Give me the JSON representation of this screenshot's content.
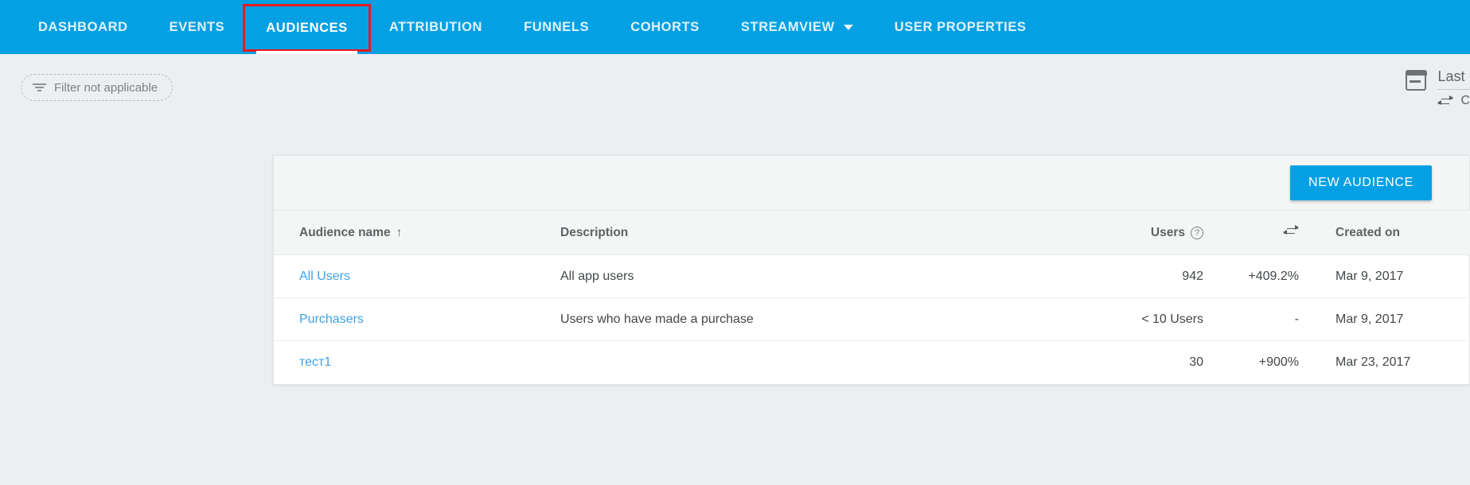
{
  "nav": {
    "items": [
      {
        "label": "DASHBOARD",
        "active": false,
        "has_caret": false
      },
      {
        "label": "EVENTS",
        "active": false,
        "has_caret": false
      },
      {
        "label": "AUDIENCES",
        "active": true,
        "has_caret": false
      },
      {
        "label": "ATTRIBUTION",
        "active": false,
        "has_caret": false
      },
      {
        "label": "FUNNELS",
        "active": false,
        "has_caret": false
      },
      {
        "label": "COHORTS",
        "active": false,
        "has_caret": false
      },
      {
        "label": "STREAMVIEW",
        "active": false,
        "has_caret": true
      },
      {
        "label": "USER PROPERTIES",
        "active": false,
        "has_caret": false
      }
    ],
    "accent_color": "#03a0e4",
    "highlight_box_color": "#e8191d"
  },
  "filter_bar": {
    "chip_label": "Filter not applicable",
    "date_range_line1": "Last",
    "date_range_line2": "C"
  },
  "card": {
    "new_audience_button": "NEW AUDIENCE",
    "columns": {
      "name": "Audience name",
      "name_sort_arrow": "↑",
      "description": "Description",
      "users": "Users",
      "users_help": "?",
      "compare": "",
      "created_on": "Created on"
    },
    "rows": [
      {
        "name": "All Users",
        "description": "All app users",
        "users": "942",
        "delta": "+409.2%",
        "delta_sign": "positive",
        "created_on": "Mar 9, 2017"
      },
      {
        "name": "Purchasers",
        "description": "Users who have made a purchase",
        "users": "< 10 Users",
        "delta": "-",
        "delta_sign": "neutral",
        "created_on": "Mar 9, 2017"
      },
      {
        "name": "тест1",
        "description": "",
        "users": "30",
        "delta": "+900%",
        "delta_sign": "positive",
        "created_on": "Mar 23, 2017"
      }
    ]
  },
  "colors": {
    "accent": "#03a0e4",
    "link": "#3ca3e8",
    "positive": "#21a9a0",
    "page_bg": "#eceff1"
  }
}
